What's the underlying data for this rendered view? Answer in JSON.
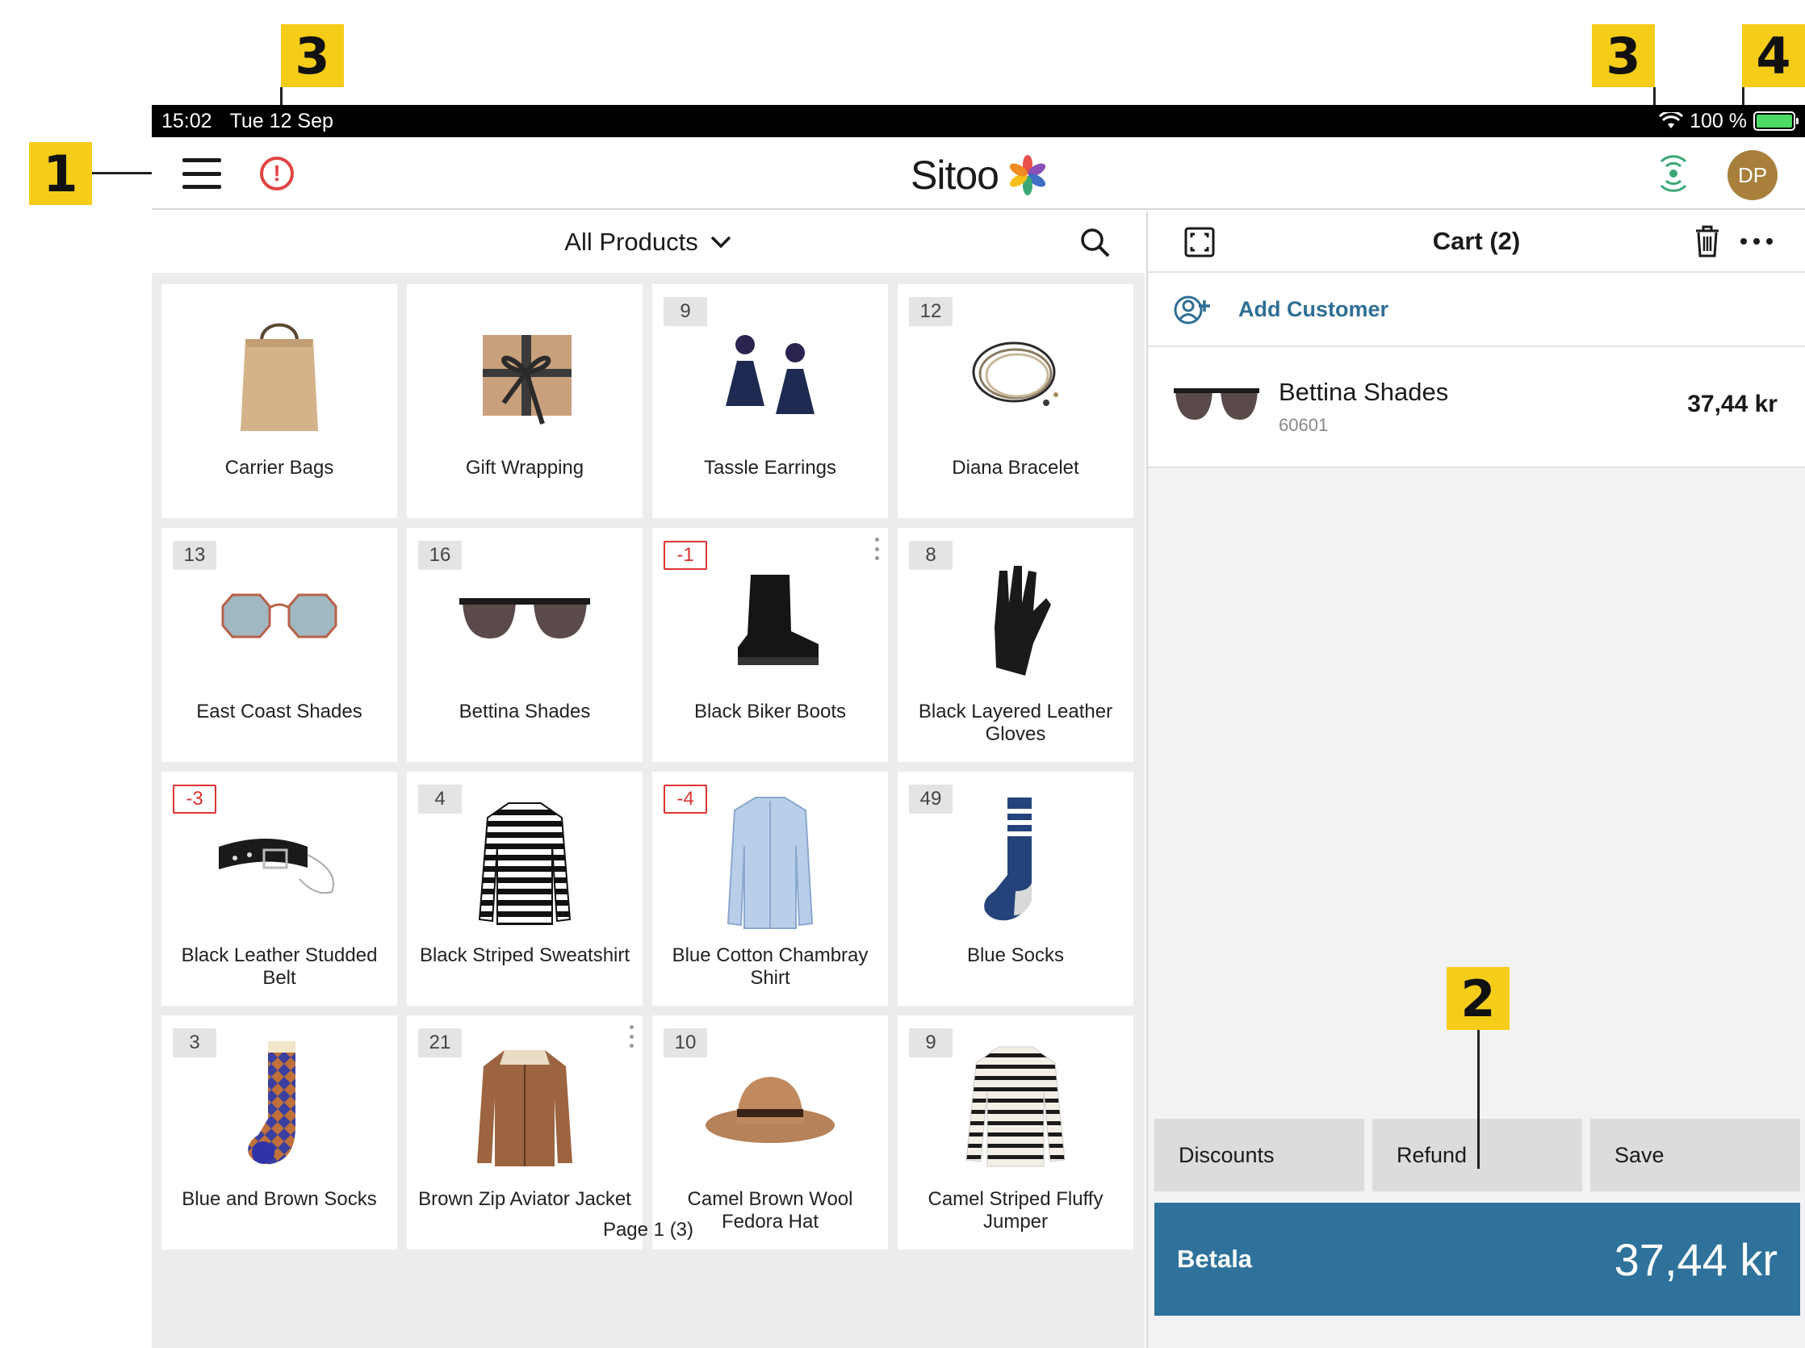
{
  "status_bar": {
    "time": "15:02",
    "date": "Tue 12 Sep",
    "battery": "100 %"
  },
  "header": {
    "logo": "Sitoo",
    "user_initials": "DP"
  },
  "callouts": {
    "menu": "1",
    "cart_actions": "2",
    "alert": "3",
    "connection": "3",
    "user": "4"
  },
  "products": {
    "category": "All Products",
    "pagination": "Page 1 (3)",
    "items": [
      {
        "name": "Carrier Bags",
        "stock": ""
      },
      {
        "name": "Gift Wrapping",
        "stock": ""
      },
      {
        "name": "Tassle Earrings",
        "stock": "9"
      },
      {
        "name": "Diana Bracelet",
        "stock": "12"
      },
      {
        "name": "East Coast Shades",
        "stock": "13"
      },
      {
        "name": "Bettina Shades",
        "stock": "16"
      },
      {
        "name": "Black Biker Boots",
        "stock": "-1"
      },
      {
        "name": "Black Layered Leather Gloves",
        "stock": "8"
      },
      {
        "name": "Black Leather Studded Belt",
        "stock": "-3"
      },
      {
        "name": "Black Striped Sweatshirt",
        "stock": "4"
      },
      {
        "name": "Blue Cotton Chambray Shirt",
        "stock": "-4"
      },
      {
        "name": "Blue Socks",
        "stock": "49"
      },
      {
        "name": "Blue and Brown Socks",
        "stock": "3"
      },
      {
        "name": "Brown Zip Aviator Jacket",
        "stock": "21"
      },
      {
        "name": "Camel Brown Wool Fedora Hat",
        "stock": "10"
      },
      {
        "name": "Camel Striped Fluffy Jumper",
        "stock": "9"
      }
    ]
  },
  "cart": {
    "title": "Cart (2)",
    "add_customer": "Add Customer",
    "lines": [
      {
        "name": "Bettina Shades",
        "sku": "60601",
        "price": "37,44 kr"
      }
    ],
    "buttons": {
      "discounts": "Discounts",
      "refund": "Refund",
      "save": "Save"
    },
    "pay_label": "Betala",
    "pay_amount": "37,44 kr"
  },
  "colors": {
    "accent": "#2e729b",
    "alert": "#e24545",
    "callout": "#f5cd19",
    "avatar": "#a8803c",
    "connected": "#3aa876"
  }
}
